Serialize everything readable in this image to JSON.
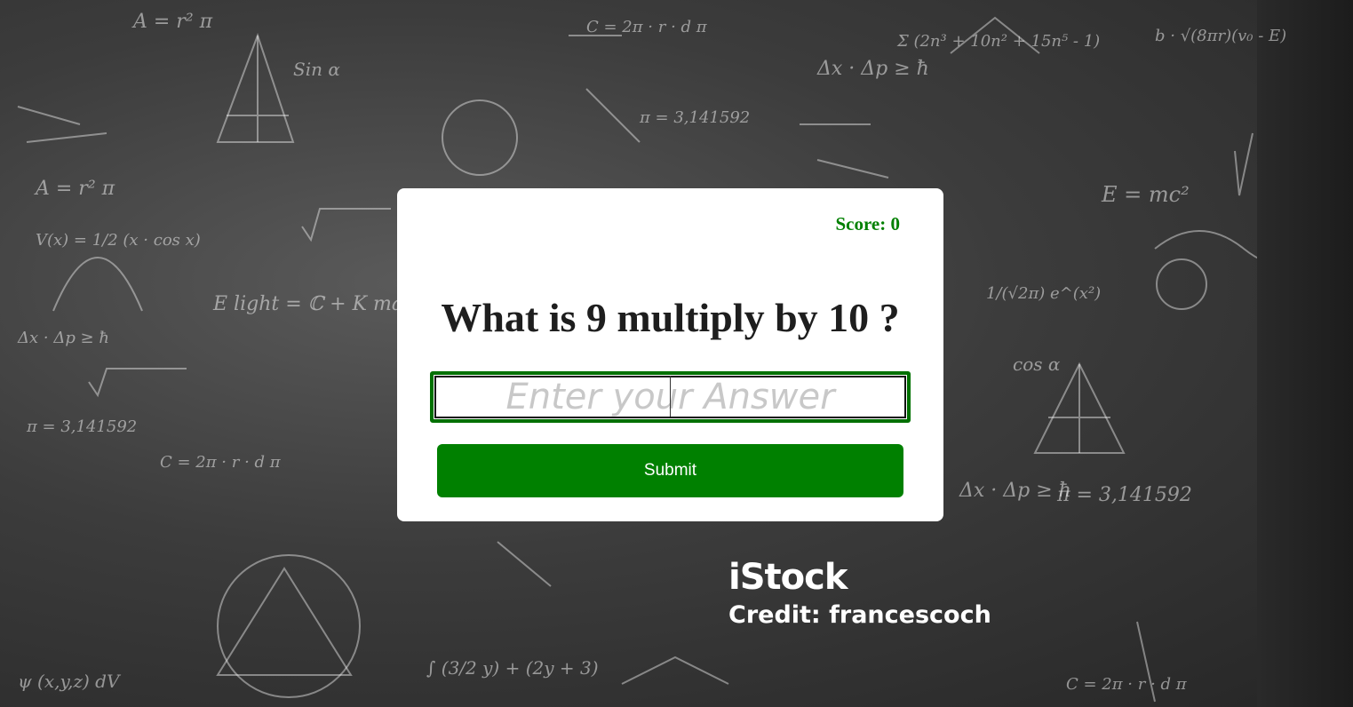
{
  "quiz": {
    "score_label": "Score: 0",
    "question": "What is 9 multiply by 10 ?",
    "answer_placeholder": "Enter your Answer",
    "answer_value": "",
    "submit_label": "Submit"
  },
  "background": {
    "watermark_brand": "iStock",
    "watermark_credit": "Credit: francescoch",
    "chalk_formulas": [
      "A = r² π",
      "C = 2π · r · d π",
      "E = mc²",
      "Δx · Δp ≥ ħ",
      "π = 3,141592",
      "Sin α",
      "cos α",
      "E light = ℂ + K max",
      "b · √(8πr)(v₀ - E)",
      "Σ (2n³ + 10n² + 15n⁵ - 1)",
      "∫ (3/2 y) + (2y + 3)",
      "V(x) = 1/2 (x · cos x)",
      "ψ (x,y,z) dV",
      "1/(√2π) e^(x²)"
    ]
  },
  "colors": {
    "accent": "#008000",
    "card": "#ffffff",
    "question_text": "#1e1e1e",
    "placeholder": "#c8c8c8"
  }
}
